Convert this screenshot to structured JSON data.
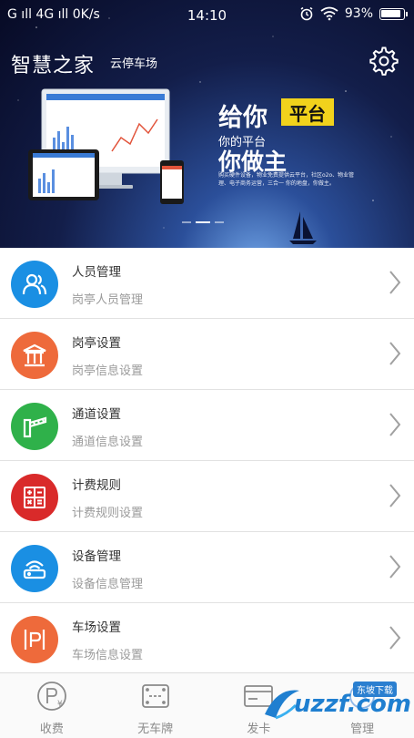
{
  "status_bar": {
    "carrier": "G ıll 4G ıll 0K/s",
    "time": "14:10",
    "battery": "93%"
  },
  "banner": {
    "brand_logo": "智慧之家",
    "brand_sub": "云停车场",
    "slogan_line1": "给你",
    "slogan_badge": "平台",
    "slogan_line2": "你的平台",
    "slogan_line3": "你做主",
    "slogan_desc": "购买硬件设备，物业免费提供云平台，社区o2o、物业管理、电子商务运营，三合一 你的地盘，你做主。",
    "carousel_active_index": 1
  },
  "menu": [
    {
      "title": "人员管理",
      "subtitle": "岗亭人员管理",
      "icon": "person-icon",
      "color": "#1a8fe3"
    },
    {
      "title": "岗亭设置",
      "subtitle": "岗亭信息设置",
      "icon": "booth-icon",
      "color": "#ee6a3b"
    },
    {
      "title": "通道设置",
      "subtitle": "通道信息设置",
      "icon": "gate-icon",
      "color": "#2fb14a"
    },
    {
      "title": "计费规则",
      "subtitle": "计费规则设置",
      "icon": "calculator-icon",
      "color": "#d92a2a"
    },
    {
      "title": "设备管理",
      "subtitle": "设备信息管理",
      "icon": "router-icon",
      "color": "#1a8fe3"
    },
    {
      "title": "车场设置",
      "subtitle": "车场信息设置",
      "icon": "parking-icon",
      "color": "#ee6a3b"
    }
  ],
  "tabbar": [
    {
      "label": "收费",
      "icon": "parking-fee-icon"
    },
    {
      "label": "无车牌",
      "icon": "no-plate-icon"
    },
    {
      "label": "发卡",
      "icon": "card-icon"
    },
    {
      "label": "管理",
      "icon": "manage-icon"
    }
  ],
  "watermark": {
    "text": "uzzf.com",
    "badge": "东坡下载"
  }
}
